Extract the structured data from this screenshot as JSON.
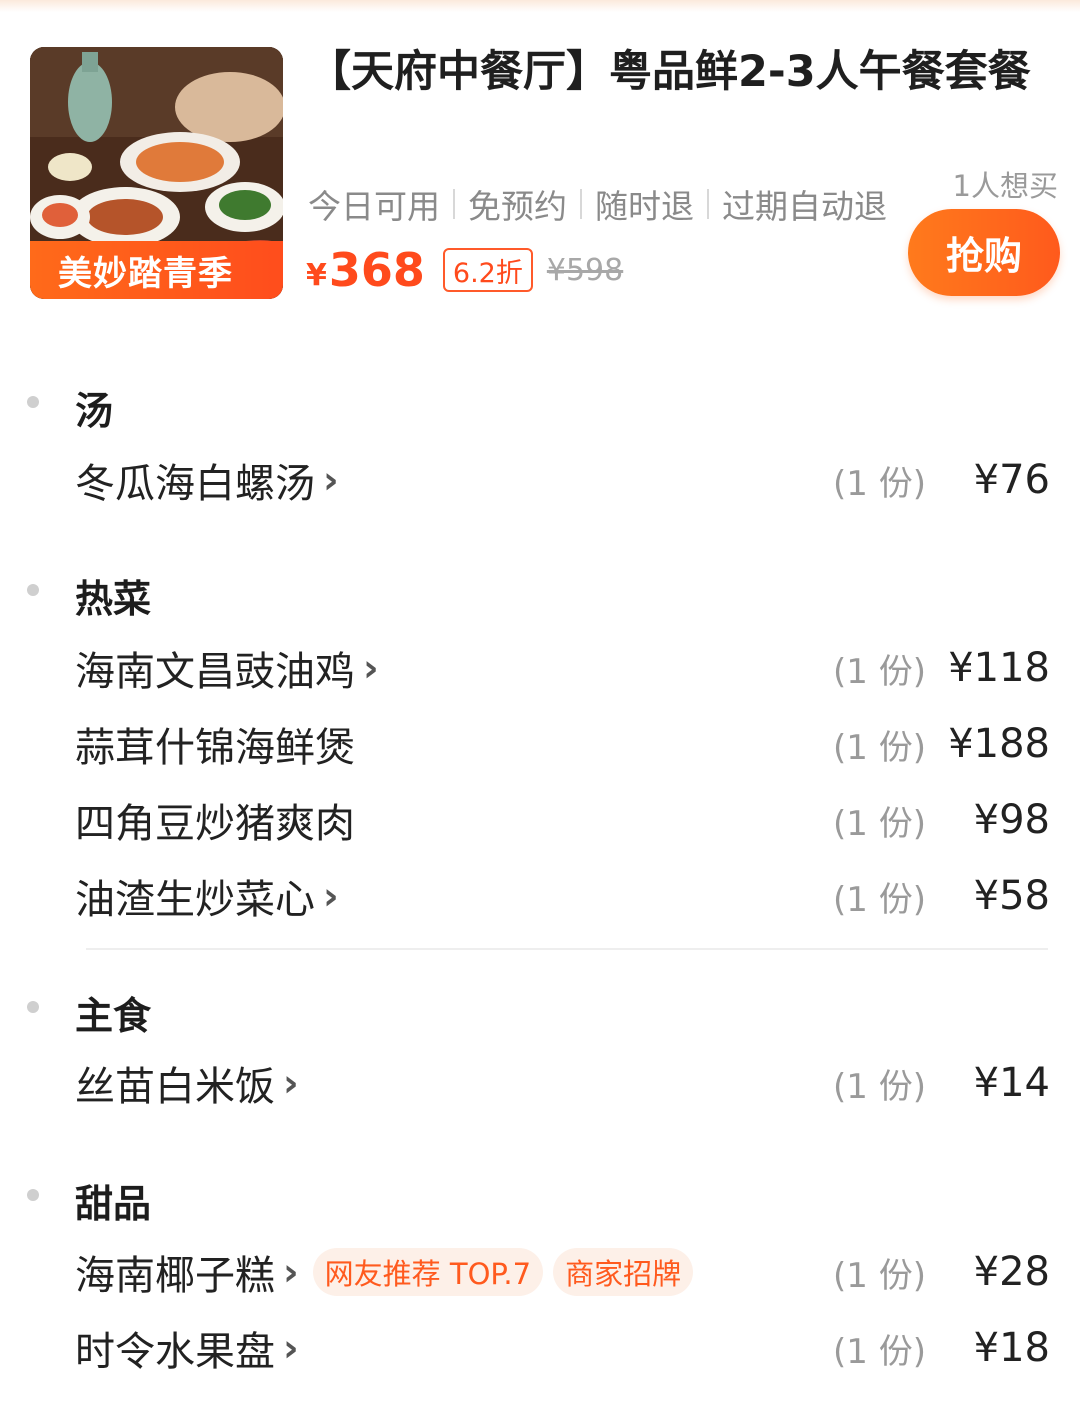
{
  "deal": {
    "image_banner": "美妙踏青季",
    "title": "【天府中餐厅】粤品鲜2-3人午餐套餐",
    "tags": [
      "今日可用",
      "免预约",
      "随时退",
      "过期自动退"
    ],
    "currency_symbol": "¥",
    "price": "368",
    "discount": "6.2折",
    "original_price": "¥598",
    "want_count": "1人想买",
    "buy_label": "抢购",
    "accent_color": "#ff4a1c"
  },
  "menu": {
    "sections": [
      {
        "title": "汤",
        "items": [
          {
            "name": "冬瓜海白螺汤",
            "has_detail": true,
            "qty": "(1 份)",
            "price": "¥76"
          }
        ]
      },
      {
        "title": "热菜",
        "items": [
          {
            "name": "海南文昌豉油鸡",
            "has_detail": true,
            "qty": "(1 份)",
            "price": "¥118"
          },
          {
            "name": "蒜茸什锦海鲜煲",
            "has_detail": false,
            "qty": "(1 份)",
            "price": "¥188"
          },
          {
            "name": "四角豆炒猪爽肉",
            "has_detail": false,
            "qty": "(1 份)",
            "price": "¥98"
          },
          {
            "name": "油渣生炒菜心",
            "has_detail": true,
            "qty": "(1 份)",
            "price": "¥58"
          }
        ]
      },
      {
        "title": "主食",
        "items": [
          {
            "name": "丝苗白米饭",
            "has_detail": true,
            "qty": "(1 份)",
            "price": "¥14"
          }
        ]
      },
      {
        "title": "甜品",
        "items": [
          {
            "name": "海南椰子糕",
            "has_detail": true,
            "qty": "(1 份)",
            "price": "¥28",
            "badges": [
              "网友推荐 TOP.7",
              "商家招牌"
            ]
          },
          {
            "name": "时令水果盘",
            "has_detail": true,
            "qty": "(1 份)",
            "price": "¥18"
          }
        ]
      }
    ],
    "chevron_icon": "chevron-right-icon"
  }
}
